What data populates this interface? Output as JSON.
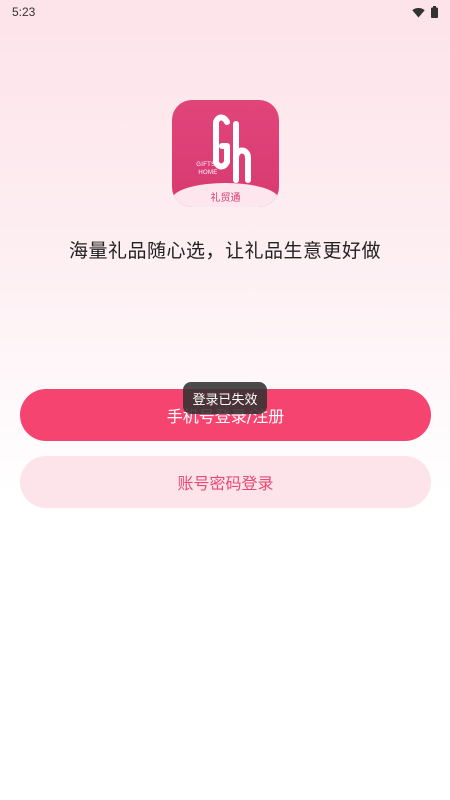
{
  "status_bar": {
    "time": "5:23",
    "icons": [
      "wifi-icon",
      "battery-icon"
    ]
  },
  "logo": {
    "mark": "Gh",
    "sub_line1": "GIFTS&",
    "sub_line2": "HOME",
    "band_text": "礼贸通",
    "colors": {
      "primary": "#d83a70",
      "band": "#fde6ee"
    }
  },
  "slogan": "海量礼品随心选，让礼品生意更好做",
  "buttons": {
    "phone_login": "手机号登录/注册",
    "account_login": "账号密码登录"
  },
  "toast": "登录已失效",
  "colors": {
    "accent": "#f5446f",
    "secondary_bg": "#fde4ea",
    "secondary_text": "#e94a72"
  }
}
